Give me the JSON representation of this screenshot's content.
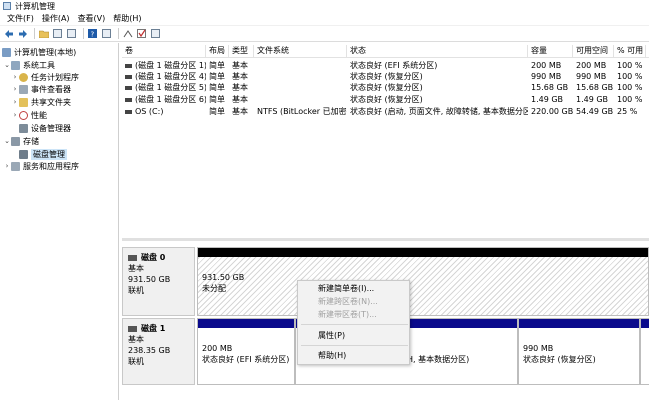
{
  "window": {
    "title": "计算机管理"
  },
  "menu": [
    "文件(F)",
    "操作(A)",
    "查看(V)",
    "帮助(H)"
  ],
  "toolbar": {
    "icons": [
      "back-arrow-icon",
      "forward-arrow-icon",
      "folder-icon",
      "properties-icon",
      "help-icon",
      "view-icon",
      "connect-icon",
      "check-icon",
      "list-icon"
    ]
  },
  "tree": {
    "root": "计算机管理(本地)",
    "system_tools": "系统工具",
    "task_scheduler": "任务计划程序",
    "event_viewer": "事件查看器",
    "shared_folders": "共享文件夹",
    "performance": "性能",
    "device_manager": "设备管理器",
    "storage": "存储",
    "disk_management": "磁盘管理",
    "services_apps": "服务和应用程序"
  },
  "volumes": {
    "headers": {
      "vol": "卷",
      "layout": "布局",
      "type": "类型",
      "fs": "文件系统",
      "status": "状态",
      "cap": "容量",
      "free": "可用空间",
      "pct": "% 可用"
    },
    "rows": [
      {
        "vol": "(磁盘 1 磁盘分区 1)",
        "layout": "简单",
        "type": "基本",
        "fs": "",
        "status": "状态良好 (EFI 系统分区)",
        "cap": "200 MB",
        "free": "200 MB",
        "pct": "100 %"
      },
      {
        "vol": "(磁盘 1 磁盘分区 4)",
        "layout": "简单",
        "type": "基本",
        "fs": "",
        "status": "状态良好 (恢复分区)",
        "cap": "990 MB",
        "free": "990 MB",
        "pct": "100 %"
      },
      {
        "vol": "(磁盘 1 磁盘分区 5)",
        "layout": "简单",
        "type": "基本",
        "fs": "",
        "status": "状态良好 (恢复分区)",
        "cap": "15.68 GB",
        "free": "15.68 GB",
        "pct": "100 %"
      },
      {
        "vol": "(磁盘 1 磁盘分区 6)",
        "layout": "简单",
        "type": "基本",
        "fs": "",
        "status": "状态良好 (恢复分区)",
        "cap": "1.49 GB",
        "free": "1.49 GB",
        "pct": "100 %"
      },
      {
        "vol": "OS (C:)",
        "layout": "简单",
        "type": "基本",
        "fs": "NTFS (BitLocker 已加密)",
        "status": "状态良好 (启动, 页面文件, 故障转储, 基本数据分区)",
        "cap": "220.00 GB",
        "free": "54.49 GB",
        "pct": "25 %"
      }
    ]
  },
  "disks": {
    "disk0": {
      "name": "磁盘 0",
      "type": "基本",
      "size": "931.50 GB",
      "status": "联机",
      "part1": {
        "size": "931.50 GB",
        "status": "未分配"
      }
    },
    "disk1": {
      "name": "磁盘 1",
      "type": "基本",
      "size": "238.35 GB",
      "status": "联机",
      "part1": {
        "size": "200 MB",
        "status": "状态良好 (EFI 系统分区)"
      },
      "part3": {
        "status": "H, 基本数据分区)"
      },
      "part4": {
        "size": "990 MB",
        "status": "状态良好 (恢复分区)"
      }
    }
  },
  "context_menu": {
    "new_simple": "新建简单卷(I)...",
    "new_spanned": "新建跨区卷(N)...",
    "new_striped": "新建带区卷(T)...",
    "properties": "属性(P)",
    "help": "帮助(H)"
  },
  "colors": {
    "primary_bar": "#0a0a8c",
    "unallocated_bar": "#000000",
    "selection": "#cce4f7"
  }
}
